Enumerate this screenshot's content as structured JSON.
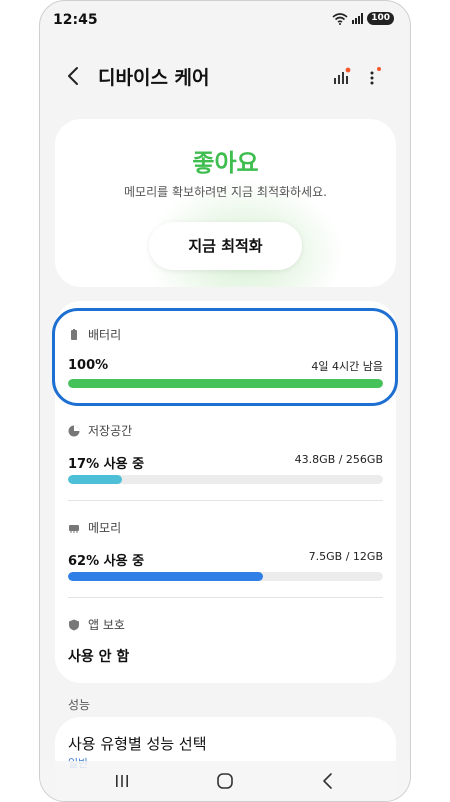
{
  "status_bar": {
    "time": "12:45",
    "battery_level": "100"
  },
  "header": {
    "title": "디바이스 케어"
  },
  "status_card": {
    "status": "좋아요",
    "description": "메모리를 확보하려면 지금 최적화하세요.",
    "button_label": "지금 최적화"
  },
  "battery": {
    "label": "배터리",
    "percent_label": "100%",
    "remaining": "4일 4시간 남음",
    "fill_percent": 100
  },
  "storage": {
    "label": "저장공간",
    "usage_label": "17% 사용 중",
    "amount": "43.8GB / 256GB",
    "fill_percent": 17
  },
  "memory": {
    "label": "메모리",
    "usage_label": "62% 사용 중",
    "amount": "7.5GB / 12GB",
    "fill_percent": 62
  },
  "app_protection": {
    "label": "앱 보호",
    "value": "사용 안 함"
  },
  "performance": {
    "section_label": "성능",
    "title": "사용 유형별 성능 선택",
    "subtitle": "일반"
  },
  "colors": {
    "accent_green": "#3fbd4f",
    "battery_bar": "#45c25a",
    "storage_bar": "#4dbfd6",
    "memory_bar": "#2f7fe6",
    "highlight": "#1d6fd1",
    "notification_dot": "#f2582c"
  }
}
